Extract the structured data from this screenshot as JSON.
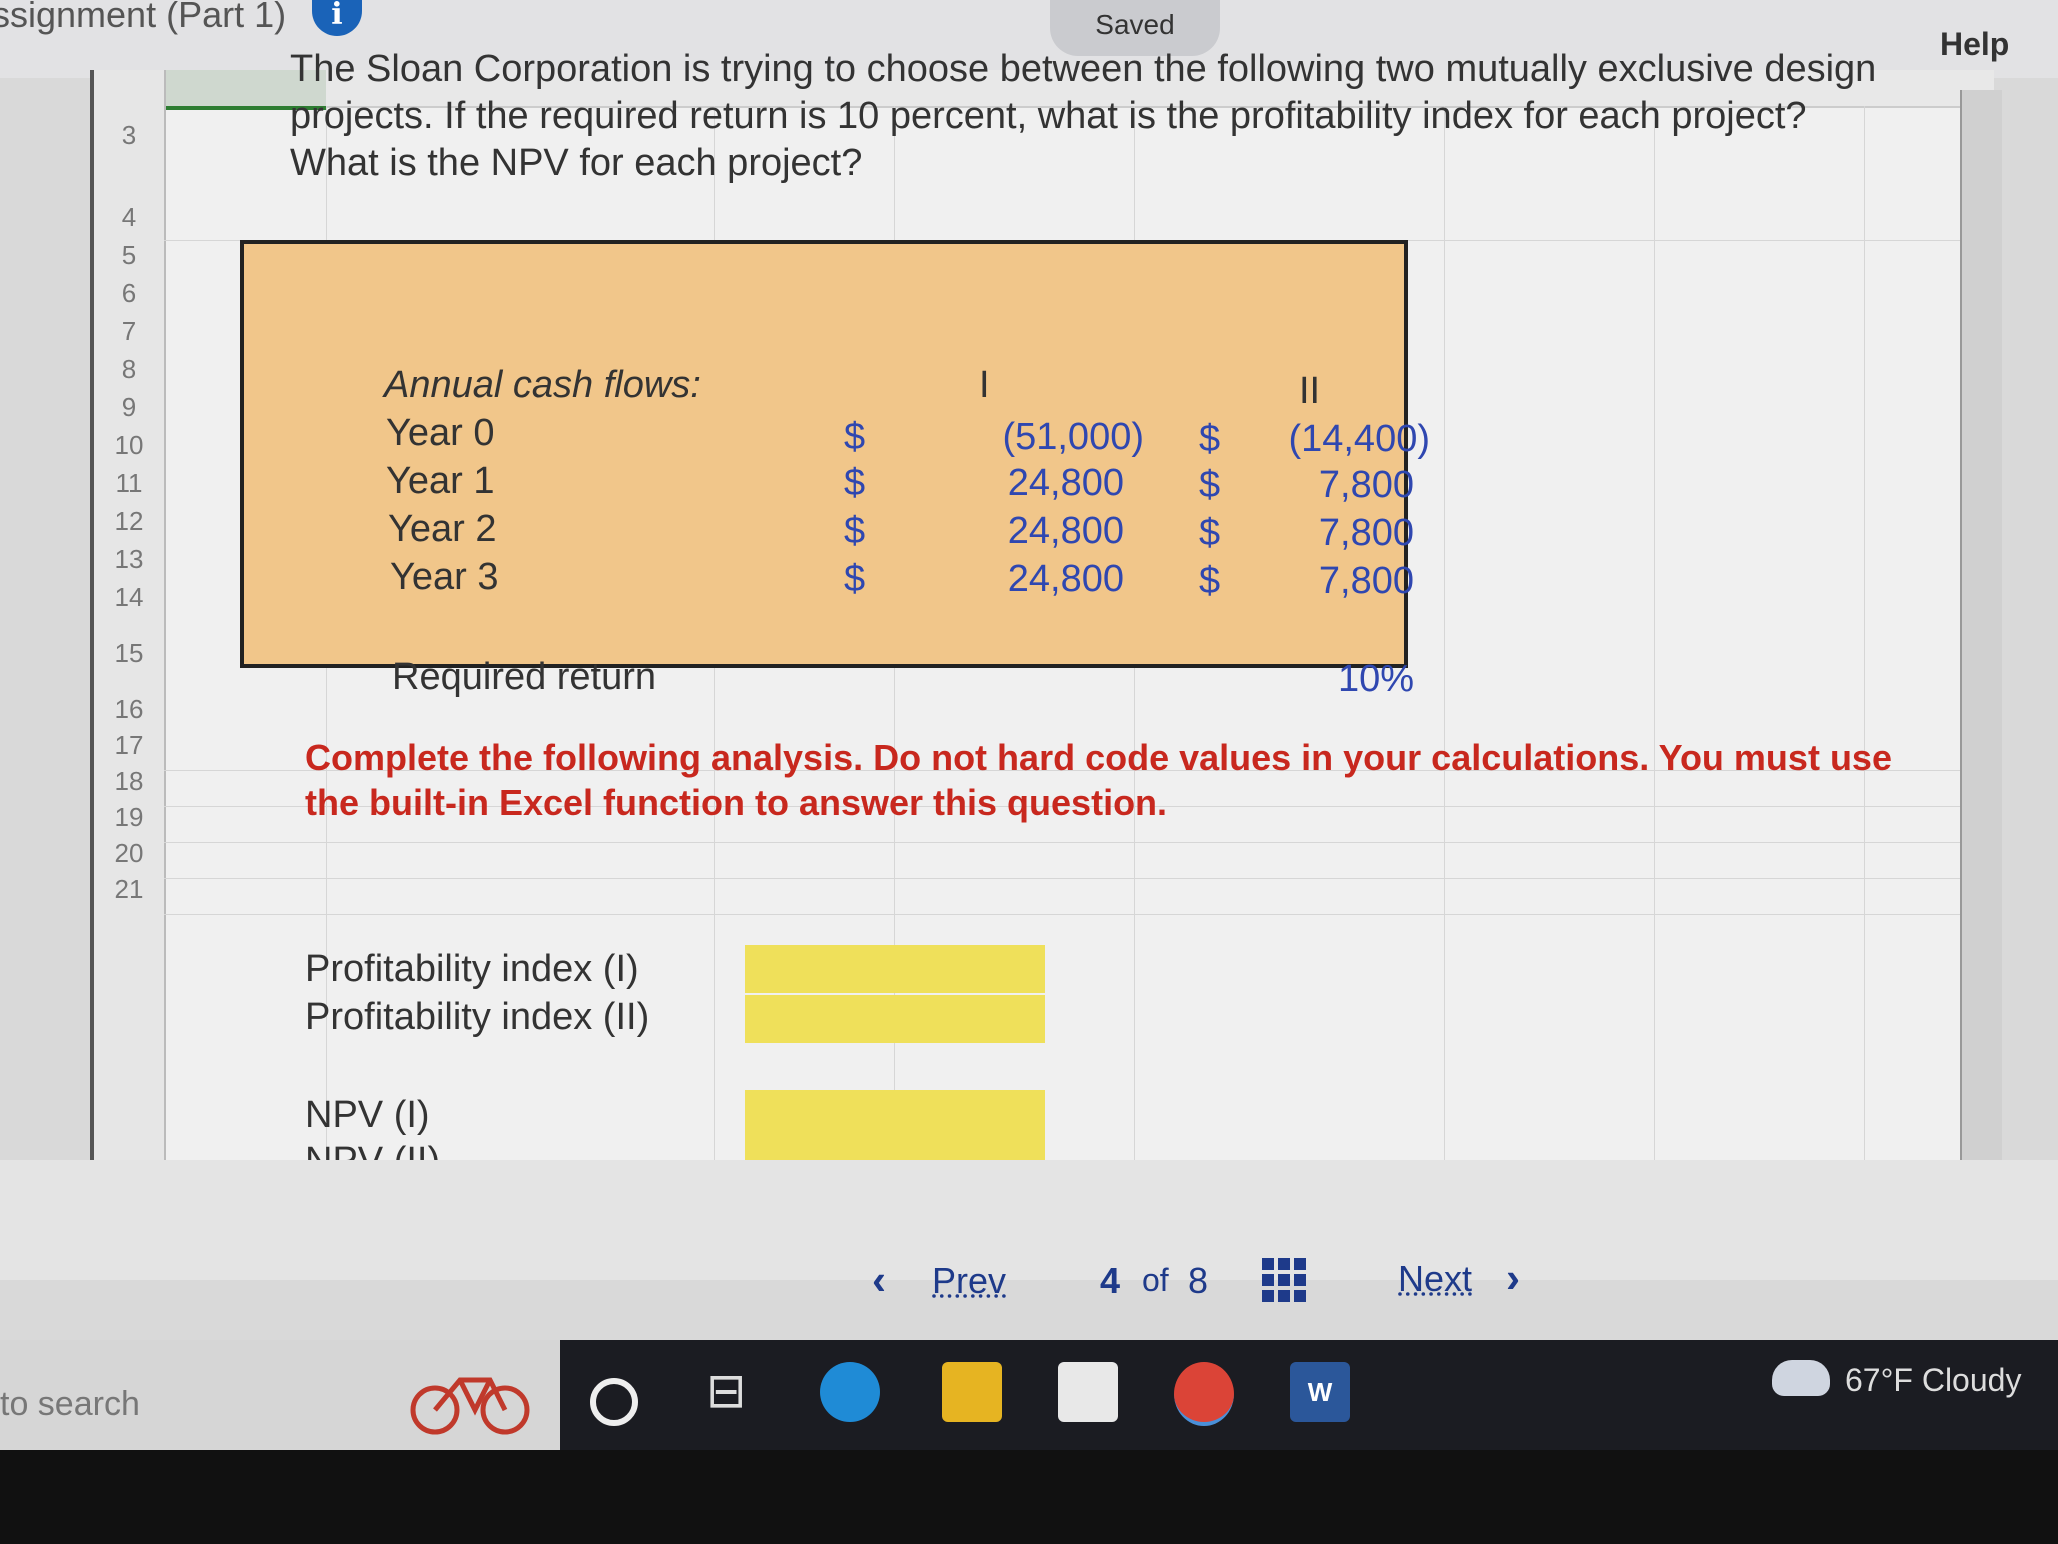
{
  "header": {
    "assignment_title": "ssignment (Part 1)",
    "info_icon": "i",
    "saved_status": "Saved",
    "help_label": "Help"
  },
  "sheet": {
    "row_numbers": [
      "3",
      "4",
      "5",
      "6",
      "7",
      "8",
      "9",
      "10",
      "11",
      "12",
      "13",
      "14",
      "15",
      "16",
      "17",
      "18",
      "19",
      "20",
      "21"
    ],
    "question": "The Sloan Corporation is trying to choose between the following two mutually exclusive design projects. If the required return is 10 percent, what is the profitability index for each project? What is the NPV for each project?",
    "cash_flows": {
      "heading": "Annual cash flows:",
      "col_i": "I",
      "col_ii": "II",
      "currency": "$",
      "rows": [
        {
          "label": "Year 0",
          "i": "(51,000)",
          "ii": "(14,400)"
        },
        {
          "label": "Year 1",
          "i": "24,800",
          "ii": "7,800"
        },
        {
          "label": "Year 2",
          "i": "24,800",
          "ii": "7,800"
        },
        {
          "label": "Year 3",
          "i": "24,800",
          "ii": "7,800"
        }
      ],
      "required_return_label": "Required return",
      "required_return_value": "10%"
    },
    "instruction": "Complete the following analysis. Do not hard code values in your calculations. You must use the built-in Excel function to answer this question.",
    "outputs": {
      "pi_i": "Profitability index (I)",
      "pi_ii": "Profitability index (II)",
      "npv_i": "NPV (I)",
      "npv_ii": "NPV (II)"
    }
  },
  "pager": {
    "prev_label": "Prev",
    "current": "4",
    "of_label": "of",
    "total": "8",
    "next_label": "Next"
  },
  "taskbar": {
    "search_text": "to search",
    "weather": "67°F  Cloudy"
  },
  "colors": {
    "cash_box": "#f1c68a",
    "input_cell": "#efe05a",
    "instruction": "#c8281e",
    "value_blue": "#2f47b0"
  }
}
